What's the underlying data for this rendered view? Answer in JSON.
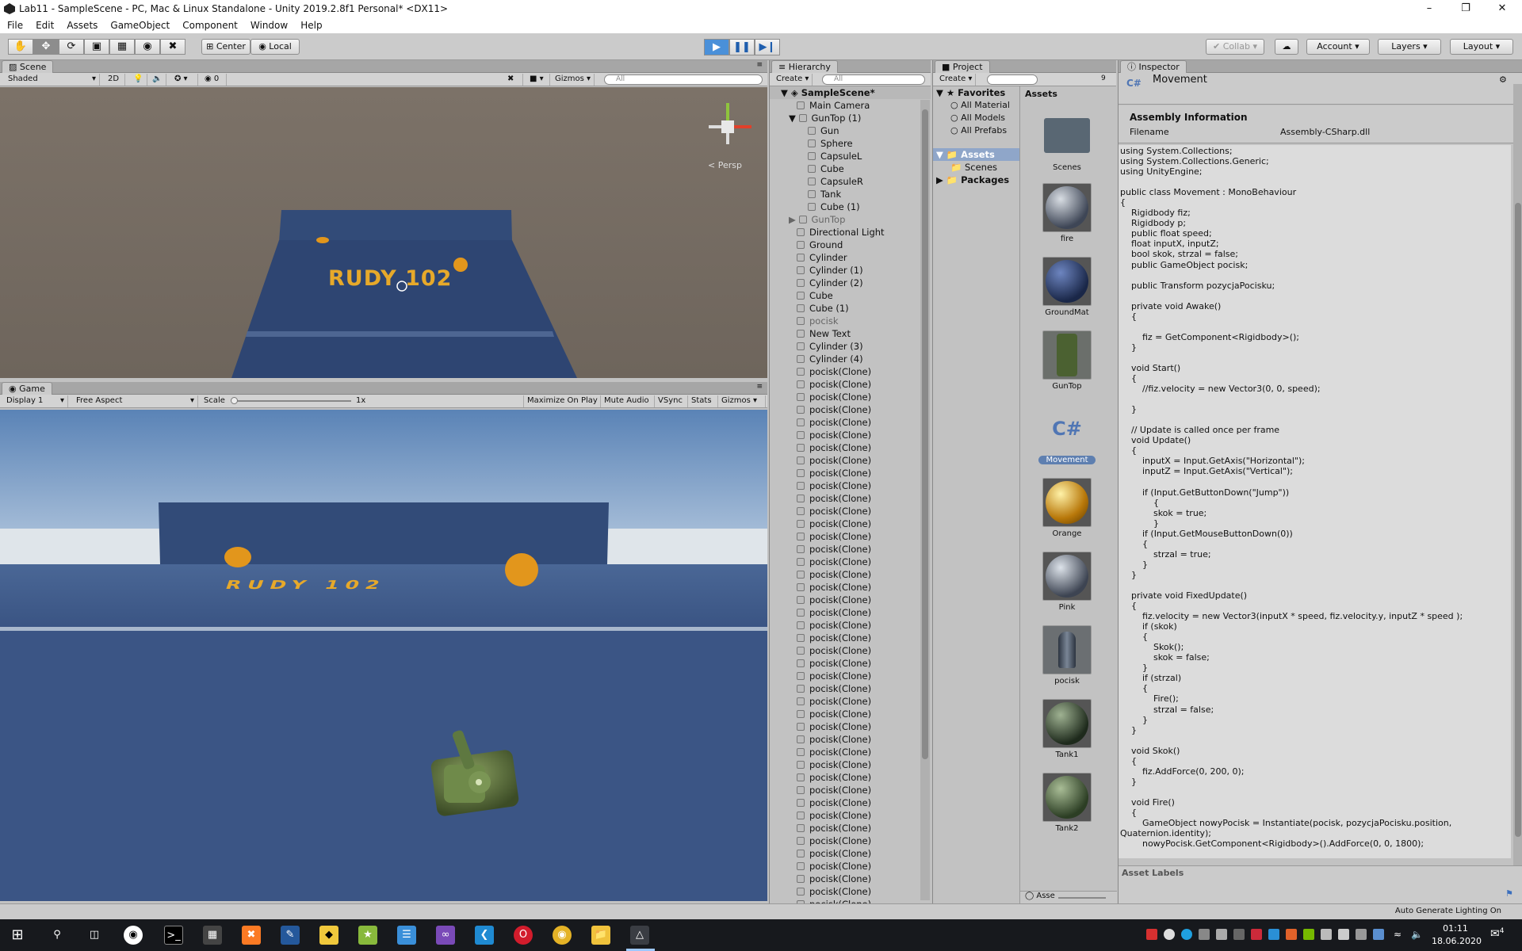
{
  "window": {
    "title": "Lab11 - SampleScene - PC, Mac & Linux Standalone - Unity 2019.2.8f1 Personal* <DX11>"
  },
  "menu": [
    "File",
    "Edit",
    "Assets",
    "GameObject",
    "Component",
    "Window",
    "Help"
  ],
  "toolbar": {
    "center": "Center",
    "local": "Local",
    "collab": "Collab",
    "account": "Account",
    "layers": "Layers",
    "layout": "Layout"
  },
  "scene": {
    "tab": "Scene",
    "shading": "Shaded",
    "mode2d": "2D",
    "fxcount": "0",
    "gizmos": "Gizmos",
    "search_placeholder": "All",
    "persp": "Persp",
    "floor_text": "RUDY 102"
  },
  "game": {
    "tab": "Game",
    "display": "Display 1",
    "aspect": "Free Aspect",
    "scale_label": "Scale",
    "scale_value": "1x",
    "maximize": "Maximize On Play",
    "mute": "Mute Audio",
    "vsync": "VSync",
    "stats": "Stats",
    "gizmos": "Gizmos",
    "floor_text": "RUDY 102"
  },
  "hierarchy": {
    "tab": "Hierarchy",
    "create": "Create",
    "search_placeholder": "All",
    "scene_name": "SampleScene*",
    "items": [
      "Main Camera",
      "GunTop (1)",
      "Gun",
      "Sphere",
      "CapsuleL",
      "Cube",
      "CapsuleR",
      "Tank",
      "Cube (1)",
      "GunTop",
      "Directional Light",
      "Ground",
      "Cylinder",
      "Cylinder (1)",
      "Cylinder (2)",
      "Cube",
      "Cube (1)",
      "pocisk",
      "New Text",
      "Cylinder (3)",
      "Cylinder (4)"
    ],
    "clone_label": "pocisk(Clone)",
    "clone_count": 43
  },
  "project": {
    "tab": "Project",
    "create": "Create",
    "favorites": "Favorites",
    "fav_items": [
      "All Material",
      "All Models",
      "All Prefabs"
    ],
    "assets": "Assets",
    "scenes": "Scenes",
    "packages": "Packages",
    "assets_header": "Assets",
    "count": "9",
    "footer": "Asse",
    "asset_items": [
      "Scenes",
      "fire",
      "GroundMat",
      "GunTop",
      "Movement",
      "Orange",
      "Pink",
      "pocisk",
      "Tank1",
      "Tank2"
    ],
    "script_glyph": "C#"
  },
  "inspector": {
    "tab": "Inspector",
    "script_name": "Movement",
    "script_icon": "C#",
    "section": "Assembly Information",
    "filename_label": "Filename",
    "filename_value": "Assembly-CSharp.dll",
    "asset_labels": "Asset Labels",
    "code": "using System.Collections;\nusing System.Collections.Generic;\nusing UnityEngine;\n\npublic class Movement : MonoBehaviour\n{\n    Rigidbody fiz;\n    Rigidbody p;\n    public float speed;\n    float inputX, inputZ;\n    bool skok, strzal = false;\n    public GameObject pocisk;\n\n    public Transform pozycjaPocisku;\n\n    private void Awake()\n    {\n\n        fiz = GetComponent<Rigidbody>();\n    }\n\n    void Start()\n    {\n        //fiz.velocity = new Vector3(0, 0, speed);\n\n    }\n\n    // Update is called once per frame\n    void Update()\n    {\n        inputX = Input.GetAxis(\"Horizontal\");\n        inputZ = Input.GetAxis(\"Vertical\");\n\n        if (Input.GetButtonDown(\"Jump\"))\n            {\n            skok = true;\n            }\n        if (Input.GetMouseButtonDown(0))\n        {\n            strzal = true;\n        }\n    }\n\n    private void FixedUpdate()\n    {\n        fiz.velocity = new Vector3(inputX * speed, fiz.velocity.y, inputZ * speed );\n        if (skok)\n        {\n            Skok();\n            skok = false;\n        }\n        if (strzal)\n        {\n            Fire();\n            strzal = false;\n        }\n    }\n\n    void Skok()\n    {\n        fiz.AddForce(0, 200, 0);\n    }\n\n    void Fire()\n    {\n        GameObject nowyPocisk = Instantiate(pocisk, pozycjaPocisku.position,\nQuaternion.identity);\n        nowyPocisk.GetComponent<Rigidbody>().AddForce(0, 0, 1800);"
  },
  "statusbar": {
    "right": "Auto Generate Lighting On"
  },
  "taskbar": {
    "time": "01:11",
    "date": "18.06.2020",
    "notif": "4"
  },
  "colors": {
    "play_active": "#4a90d9",
    "scene_floor": "#2f4773",
    "sky_top": "#5a83b6",
    "orange": "#e2961c"
  }
}
